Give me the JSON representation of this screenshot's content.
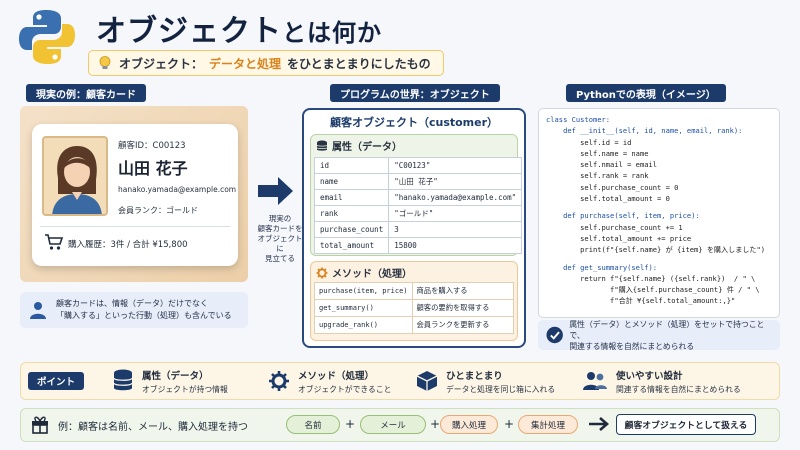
{
  "header": {
    "title_main": "オブジェクト",
    "title_rest": "とは何か",
    "subtitle_prefix": "オブジェクト：",
    "subtitle_highlight": "データと処理",
    "subtitle_suffix": "をひとまとまりにしたもの"
  },
  "sections": {
    "left": "現実の例：顧客カード",
    "middle": "プログラムの世界：オブジェクト",
    "right": "Pythonでの表現（イメージ）"
  },
  "card": {
    "id_line": "顧客ID：C00123",
    "name": "山田 花子",
    "email": "hanako.yamada@example.com",
    "rank": "会員ランク：ゴールド",
    "history": "購入履歴：3件 / 合計 ¥15,800"
  },
  "left_note": {
    "line1": "顧客カードは、情報（データ）だけでなく",
    "line2": "「購入する」といった行動（処理）も含んでいる"
  },
  "arrow_caption": [
    "現実の",
    "顧客カードを",
    "オブジェクトに",
    "見立てる"
  ],
  "object": {
    "title": "顧客オブジェクト（customer）",
    "attributes_heading": "属性（データ）",
    "attributes": [
      {
        "key": "id",
        "value": "\"C00123\""
      },
      {
        "key": "name",
        "value": "\"山田 花子\""
      },
      {
        "key": "email",
        "value": "\"hanako.yamada@example.com\""
      },
      {
        "key": "rank",
        "value": "\"ゴールド\""
      },
      {
        "key": "purchase_count",
        "value": "3"
      },
      {
        "key": "total_amount",
        "value": "15800"
      }
    ],
    "methods_heading": "メソッド（処理）",
    "methods": [
      {
        "key": "purchase(item, price)",
        "value": "商品を購入する"
      },
      {
        "key": "get_summary()",
        "value": "顧客の要約を取得する"
      },
      {
        "key": "upgrade_rank()",
        "value": "会員ランクを更新する"
      }
    ]
  },
  "code": {
    "l01": "class Customer:",
    "l02": "    def __init__(self, id, name, email, rank):",
    "l03": "        self.id = id",
    "l04": "        self.name = name",
    "l05": "        self.nmail = email",
    "l06": "        self.rank = rank",
    "l07": "        self.purchase_count = 0",
    "l08": "        self.total_amount = 0",
    "l09": "    def purchase(self, item, price):",
    "l10": "        self.purchase_count += 1",
    "l11": "        self.total_amount += price",
    "l12": "        print(f\"{self.name} が {item} を購入しました\")",
    "l13": "    def get_summary(self):",
    "l14": "        return f\"{self.name} ({self.rank})  / \" \\",
    "l15": "               f\"購入{self.purchase_count} 件 / \" \\",
    "l16": "               f\"合計 ¥{self.total_amount:,}\""
  },
  "right_note": {
    "line1": "属性（データ）とメソッド（処理）をセットで持つことで、",
    "line2": "関連する情報を自然にまとめられる"
  },
  "points": {
    "label": "ポイント",
    "items": [
      {
        "title": "属性（データ）",
        "desc": "オブジェクトが持つ情報"
      },
      {
        "title": "メソッド（処理）",
        "desc": "オブジェクトができること"
      },
      {
        "title": "ひとまとまり",
        "desc": "データと処理を同じ箱に入れる"
      },
      {
        "title": "使いやすい設計",
        "desc": "関連する情報を自然にまとめられる"
      }
    ]
  },
  "example": {
    "text": "例：顧客は名前、メール、購入処理を持つ",
    "pills": [
      "名前",
      "メール",
      "購入処理",
      "集計処理"
    ],
    "plus": "+",
    "result": "顧客オブジェクトとして扱える"
  },
  "colors": {
    "navy": "#1c3b6b",
    "accent_orange": "#d9821a",
    "attr_green": "#eef5e8",
    "method_orange": "#fdf1e2"
  }
}
